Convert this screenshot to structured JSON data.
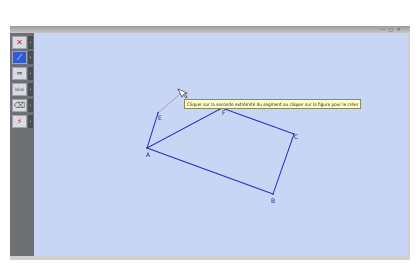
{
  "toolbar": {
    "tools": [
      {
        "name": "delete-tool",
        "glyph": "✕",
        "color": "#d01818"
      },
      {
        "name": "segment-tool",
        "glyph": "⟋",
        "color": "#ffffff"
      },
      {
        "name": "lines-tool",
        "glyph": "═",
        "color": "#555555"
      },
      {
        "name": "label-tool",
        "glyph": "label",
        "color": "#555555"
      },
      {
        "name": "eraser-tool",
        "glyph": "⌫",
        "color": "#555555"
      },
      {
        "name": "magnet-tool",
        "glyph": "⚡",
        "color": "#d01818"
      }
    ]
  },
  "figure": {
    "points": {
      "A": "A",
      "B": "B",
      "C": "C",
      "E": "E",
      "F": "F"
    }
  },
  "tooltip": {
    "text": "Cliquer sur la seconde extrémité du segment ou cliquer sur la figure pour le créer"
  },
  "colors": {
    "canvas": "#c8d5f5",
    "shape": "#2828c8",
    "tooltip_bg": "#ffffcc"
  }
}
